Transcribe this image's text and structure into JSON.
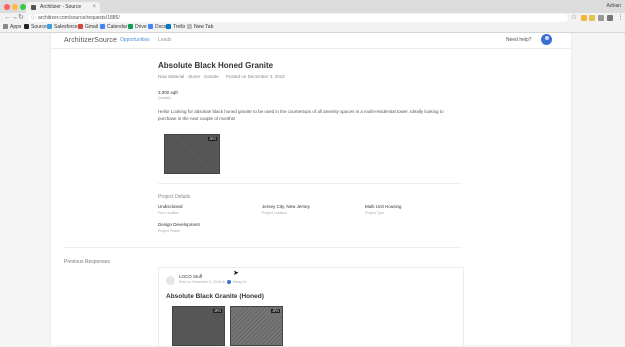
{
  "browser": {
    "tab_title": "Architizer - Source",
    "profile_name": "Adrian",
    "url": "architizer.com/source/requests/1885/",
    "bookmarks": [
      "Apps",
      "Source",
      "Salesforce",
      "Gmail",
      "Calendar",
      "Drive",
      "Docs",
      "Trello",
      "New Tab"
    ]
  },
  "header": {
    "logo": "ArchitizerSource",
    "nav": [
      "Opportunities",
      "Leads"
    ],
    "help": "Need help?"
  },
  "request": {
    "title": "Absolute Black Honed Granite",
    "breadcrumb": "Raw Material · Stone · Granite",
    "posted": "Posted on December 3, 2018",
    "quantity": "3,000 sqft",
    "quantity_label": "Quantity",
    "description": "Hello! Looking for absolute black honed granite to be used in the countertops of all amenity spaces in a multi-residential tower. Ideally looking to purchase in the next couple of months!",
    "image_badge": "JPG"
  },
  "project_details": {
    "heading": "Project Details",
    "items": [
      {
        "value": "Undisclosed",
        "label": "Firm Location"
      },
      {
        "value": "Jersey City, New Jersey",
        "label": "Project Location"
      },
      {
        "value": "Multi Unit Housing",
        "label": "Project Type"
      },
      {
        "value": "Design Development",
        "label": "Project Phase"
      }
    ]
  },
  "responses": {
    "heading": "Previous Responses",
    "company": "LOCO Stuff",
    "sent": "Sent on December 3, 2018 to",
    "recipient": "Meng Ke",
    "title": "Absolute Black Granite (Honed)",
    "badge": "JPG"
  },
  "colors": {
    "accent": "#4a90d9",
    "avatar": "#3b6fd3"
  }
}
